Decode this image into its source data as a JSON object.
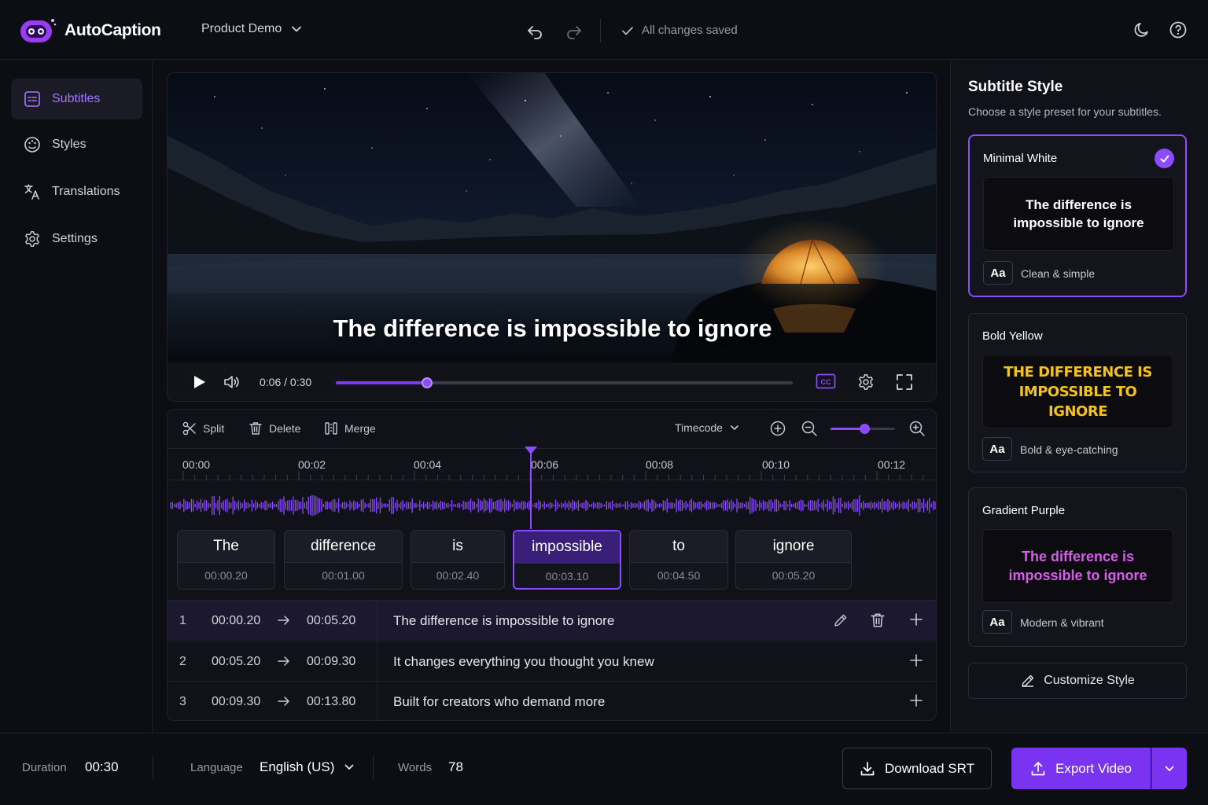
{
  "app": {
    "name": "AutoCaption",
    "project": "Product Demo",
    "save_status": "All changes saved"
  },
  "sidebar": {
    "items": [
      {
        "label": "Subtitles",
        "icon": "subtitles-icon",
        "active": true
      },
      {
        "label": "Styles",
        "icon": "palette-icon",
        "active": false
      },
      {
        "label": "Translations",
        "icon": "translate-icon",
        "active": false
      },
      {
        "label": "Settings",
        "icon": "gear-icon",
        "active": false
      }
    ]
  },
  "player": {
    "caption": "The difference is impossible to ignore",
    "time": "0:06 / 0:30",
    "progress": 0.2
  },
  "timeline": {
    "tools": {
      "split": "Split",
      "delete": "Delete",
      "merge": "Merge"
    },
    "format": "Timecode",
    "zoom_level": 0.52,
    "ticks": [
      "00:00",
      "00:02",
      "00:04",
      "00:06",
      "00:08",
      "00:10",
      "00:12"
    ],
    "playhead_time": "00:05.20",
    "words": [
      {
        "text": "The",
        "time": "00:00.20",
        "active": false
      },
      {
        "text": "difference",
        "time": "00:01.00",
        "active": false
      },
      {
        "text": "is",
        "time": "00:02.40",
        "active": false
      },
      {
        "text": "impossible",
        "time": "00:03.10",
        "active": true
      },
      {
        "text": "to",
        "time": "00:04.50",
        "active": false
      },
      {
        "text": "ignore",
        "time": "00:05.20",
        "active": false
      }
    ],
    "rows": [
      {
        "num": "1",
        "start": "00:00.20",
        "end": "00:05.20",
        "text": "The difference is impossible to ignore",
        "active": true
      },
      {
        "num": "2",
        "start": "00:05.20",
        "end": "00:09.30",
        "text": "It changes everything you thought you knew",
        "active": false
      },
      {
        "num": "3",
        "start": "00:09.30",
        "end": "00:13.80",
        "text": "Built for creators who demand more",
        "active": false
      }
    ]
  },
  "style_panel": {
    "title": "Subtitle Style",
    "subtitle": "Choose a style preset for your subtitles.",
    "aa": "Aa",
    "presets": [
      {
        "name": "Minimal White",
        "preview": "The difference is impossible to ignore",
        "desc": "Clean & simple",
        "selected": true,
        "color": "#ffffff"
      },
      {
        "name": "Bold Yellow",
        "preview": "THE DIFFERENCE IS IMPOSSIBLE TO IGNORE",
        "desc": "Bold & eye-catching",
        "selected": false,
        "color": "#f6c21c"
      },
      {
        "name": "Gradient Purple",
        "preview": "The difference is impossible to ignore",
        "desc": "Modern & vibrant",
        "selected": false,
        "color": "#d65ee8"
      }
    ],
    "customize": "Customize Style"
  },
  "bottom": {
    "duration_label": "Duration",
    "duration": "00:30",
    "language_label": "Language",
    "language": "English (US)",
    "words_label": "Words",
    "words": "78",
    "download": "Download SRT",
    "export": "Export Video"
  },
  "colors": {
    "accent": "#8b4bff",
    "background": "#0d0d14"
  }
}
